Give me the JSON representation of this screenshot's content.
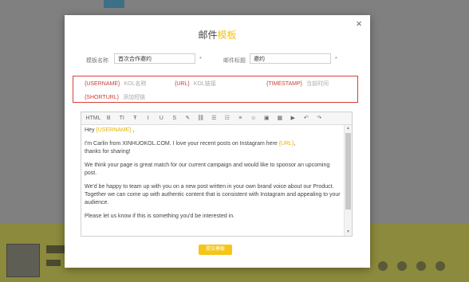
{
  "modal": {
    "title_prefix": "邮件",
    "title_accent": "模板",
    "close": "×",
    "template_name_label": "模板名称",
    "template_name_value": "首次合作邀约",
    "email_subject_label": "邮件标题",
    "email_subject_value": "邀约",
    "required_star": "*",
    "submit_label": "提交模板"
  },
  "tags": [
    {
      "token": "{USERNAME}",
      "desc": "KOL名称"
    },
    {
      "token": "{URL}",
      "desc": "KOL链接"
    },
    {
      "token": "{TIMESTAMP}",
      "desc": "当前时间"
    },
    {
      "token": "{SHORTURL}",
      "desc": "添加短链"
    }
  ],
  "toolbar": {
    "html": "HTML",
    "bold": "B",
    "italic_t": "TI",
    "strike_t": "Ŧ",
    "italic": "I",
    "underline": "U",
    "strike": "S",
    "brush": "✎",
    "link": "⛓",
    "list_ul": "☰",
    "list_ol": "☷",
    "align": "≡",
    "emoji": "☺",
    "image": "▣",
    "table": "▦",
    "video": "▶",
    "undo": "↶",
    "redo": "↷"
  },
  "editor": {
    "greeting_prefix": "Hey ",
    "greeting_token": "{USERNAME}",
    "greeting_suffix": " ,",
    "p1_text": "I'm Carlin from XINHUOKOL.COM. I love your recent posts on Instagram here ",
    "p1_token": "{URL}",
    "p1_end": ",",
    "p1_line2": "thanks for sharing!",
    "p2": "We think your page is great match for our current campaign and would like to sponsor an upcoming post.",
    "p3": "We'd be happy to team up with you on a new post written in your own brand voice about our Product. Together we can come up with authentic content that is consistent with Instagram and appealing to your audience.",
    "p4": "Please let us know if this is something you'd be interested in."
  }
}
